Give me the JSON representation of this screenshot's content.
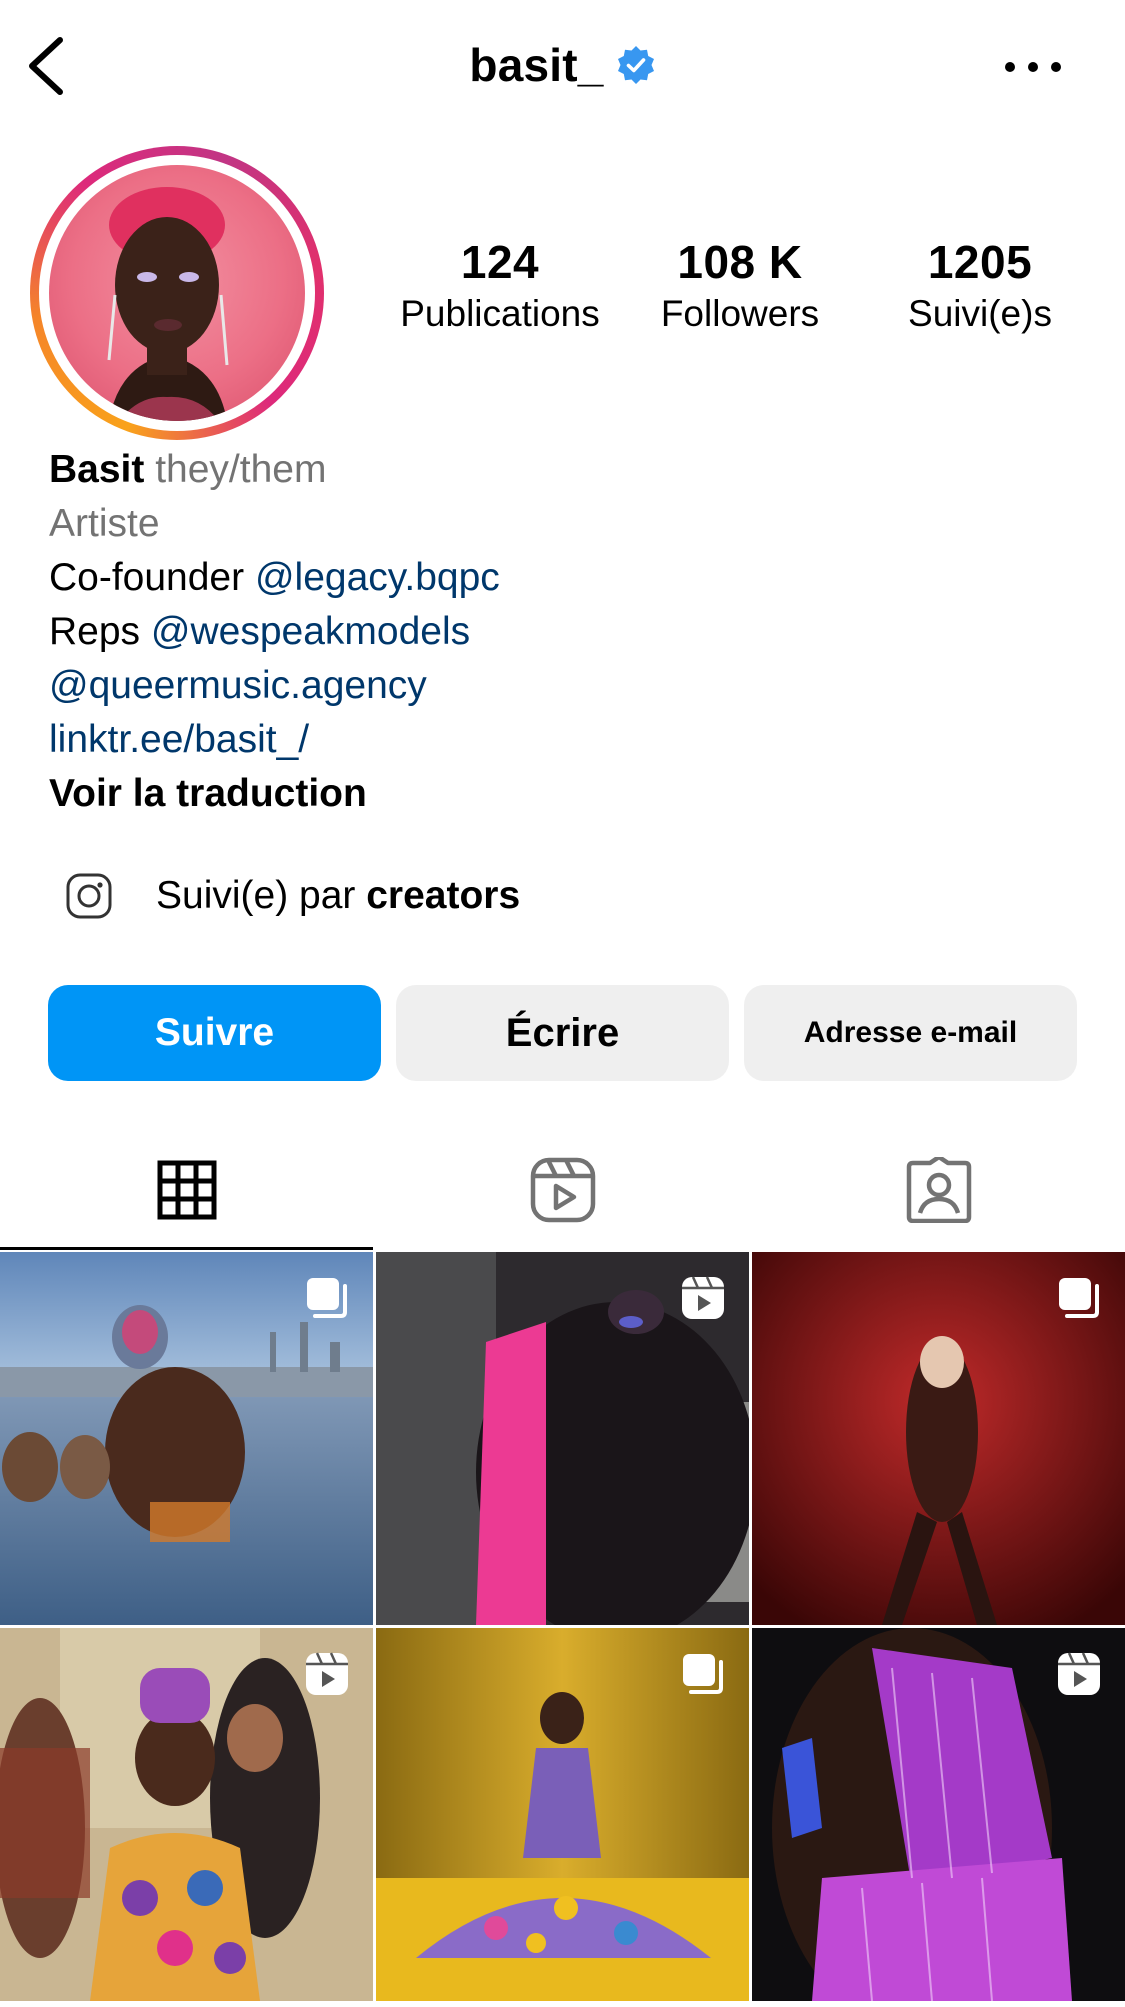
{
  "header": {
    "username": "basit_",
    "verified": true
  },
  "stats": [
    {
      "value": "124",
      "label": "Publications"
    },
    {
      "value": "108 K",
      "label": "Followers"
    },
    {
      "value": "1205",
      "label": "Suivi(e)s"
    }
  ],
  "bio": {
    "name": "Basit",
    "pronouns": "they/them",
    "category": "Artiste",
    "line1_text": "Co-founder ",
    "line1_mention": "@legacy.bqpc",
    "line2_text": "Reps ",
    "line2_mention": "@wespeakmodels",
    "line3_mention": "@queermusic.agency",
    "link": "linktr.ee/basit_/",
    "translate": "Voir la traduction"
  },
  "followed_by": {
    "prefix": "Suivi(e) par ",
    "name": "creators"
  },
  "actions": {
    "follow": "Suivre",
    "message": "Écrire",
    "email": "Adresse e-mail"
  },
  "tabs": [
    {
      "name": "posts",
      "icon": "grid-icon",
      "active": true
    },
    {
      "name": "reels",
      "icon": "reels-icon",
      "active": false
    },
    {
      "name": "tagged",
      "icon": "tagged-icon",
      "active": false
    }
  ],
  "posts": [
    {
      "badge": "carousel-icon"
    },
    {
      "badge": "reels-icon"
    },
    {
      "badge": "carousel-icon"
    },
    {
      "badge": "reels-icon"
    },
    {
      "badge": "carousel-icon"
    },
    {
      "badge": "reels-icon"
    }
  ],
  "colors": {
    "accent_blue": "#0095f6",
    "link_blue": "#00376b",
    "verified_blue": "#3897f0",
    "button_grey": "#efefef"
  }
}
